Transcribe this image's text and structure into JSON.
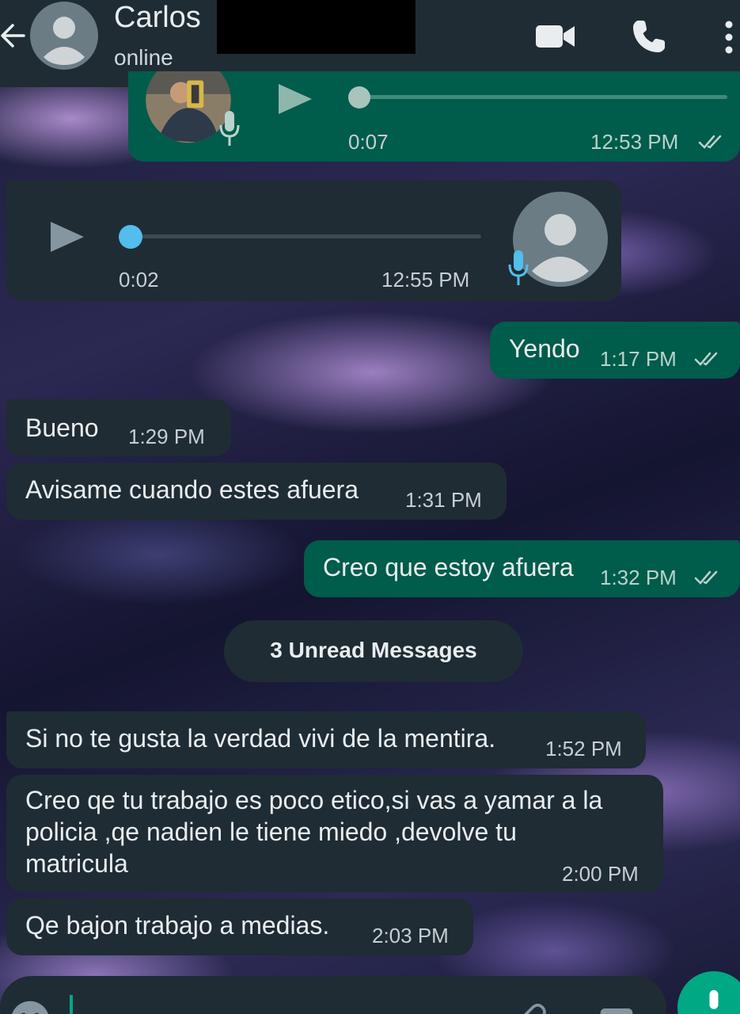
{
  "header": {
    "contact_name": "Carlos",
    "status": "online",
    "icons": [
      "back-arrow-icon",
      "avatar-placeholder-icon",
      "video-call-icon",
      "phone-icon",
      "more-vert-icon"
    ]
  },
  "messages": [
    {
      "type": "voice",
      "direction": "outgoing",
      "duration": "0:07",
      "time": "12:53 PM",
      "status": "read"
    },
    {
      "type": "voice",
      "direction": "incoming",
      "duration": "0:02",
      "time": "12:55 PM"
    },
    {
      "type": "text",
      "direction": "outgoing",
      "text": "Yendo",
      "time": "1:17 PM",
      "status": "read"
    },
    {
      "type": "text",
      "direction": "incoming",
      "text": "Bueno",
      "time": "1:29 PM"
    },
    {
      "type": "text",
      "direction": "incoming",
      "text": "Avisame cuando estes afuera",
      "time": "1:31 PM"
    },
    {
      "type": "text",
      "direction": "outgoing",
      "text": "Creo que estoy afuera",
      "time": "1:32 PM",
      "status": "read"
    },
    {
      "type": "text",
      "direction": "incoming",
      "text": "Si no te gusta la verdad vivi de la mentira.",
      "time": "1:52 PM"
    },
    {
      "type": "text",
      "direction": "incoming",
      "lines": [
        "Creo qe tu trabajo es poco etico,si vas a yamar  a la",
        "policia ,qe nadien le tiene miedo ,devolve tu",
        "matricula"
      ],
      "time": "2:00 PM"
    },
    {
      "type": "text",
      "direction": "incoming",
      "text": "Qe bajon trabajo a medias.",
      "time": "2:03 PM"
    }
  ],
  "unread_divider": "3 Unread Messages",
  "colors": {
    "header_bg": "#1f2c34",
    "outgoing_bubble": "#005c4b",
    "incoming_bubble": "#1f2c34",
    "accent_green": "#00a884",
    "read_ticks": "#b9d3cc",
    "voice_progress_incoming": "#53bdeb"
  }
}
